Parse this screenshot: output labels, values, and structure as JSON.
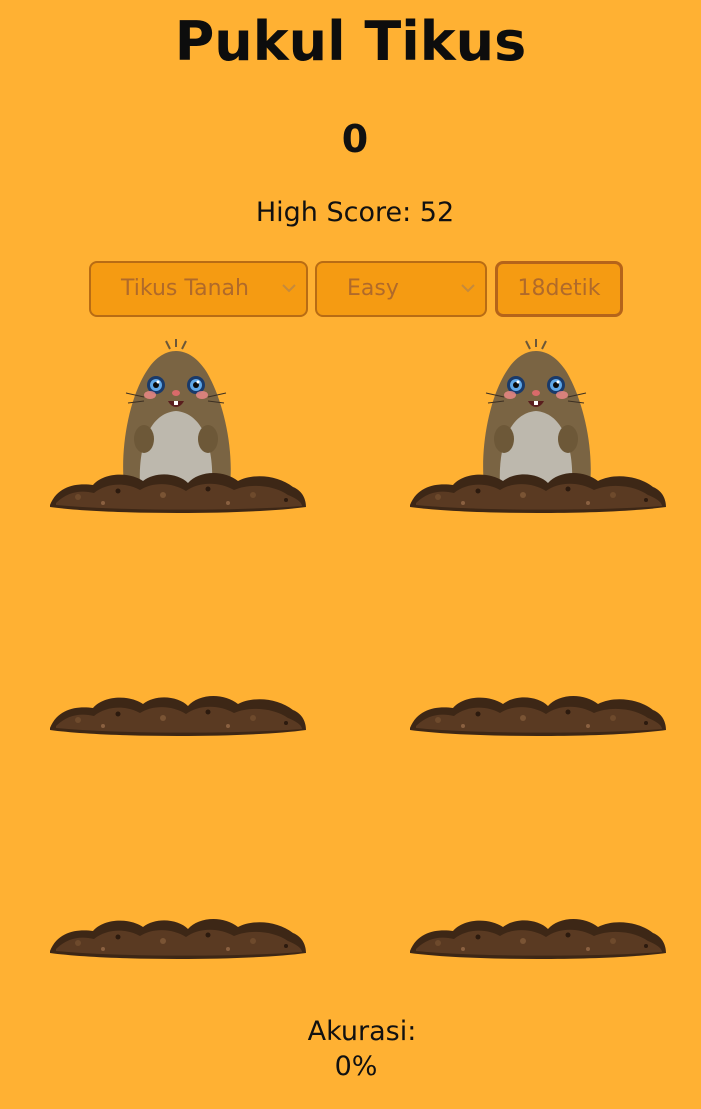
{
  "title": "Pukul Tikus",
  "score": "0",
  "high_score_text": "High Score: 52",
  "controls": {
    "mole_type": "Tikus Tanah",
    "difficulty": "Easy",
    "timer": "18detik"
  },
  "holes": [
    {
      "id": 1,
      "mole_visible": true
    },
    {
      "id": 2,
      "mole_visible": true
    },
    {
      "id": 3,
      "mole_visible": false
    },
    {
      "id": 4,
      "mole_visible": false
    },
    {
      "id": 5,
      "mole_visible": false
    },
    {
      "id": 6,
      "mole_visible": false
    }
  ],
  "accuracy": {
    "label": "Akurasi:",
    "value": "0%"
  },
  "colors": {
    "background": "#ffb133",
    "control_fill": "#f59b12",
    "control_border": "#b86c14",
    "soil": "#4a3020",
    "mole_fur": "#7a6443"
  }
}
